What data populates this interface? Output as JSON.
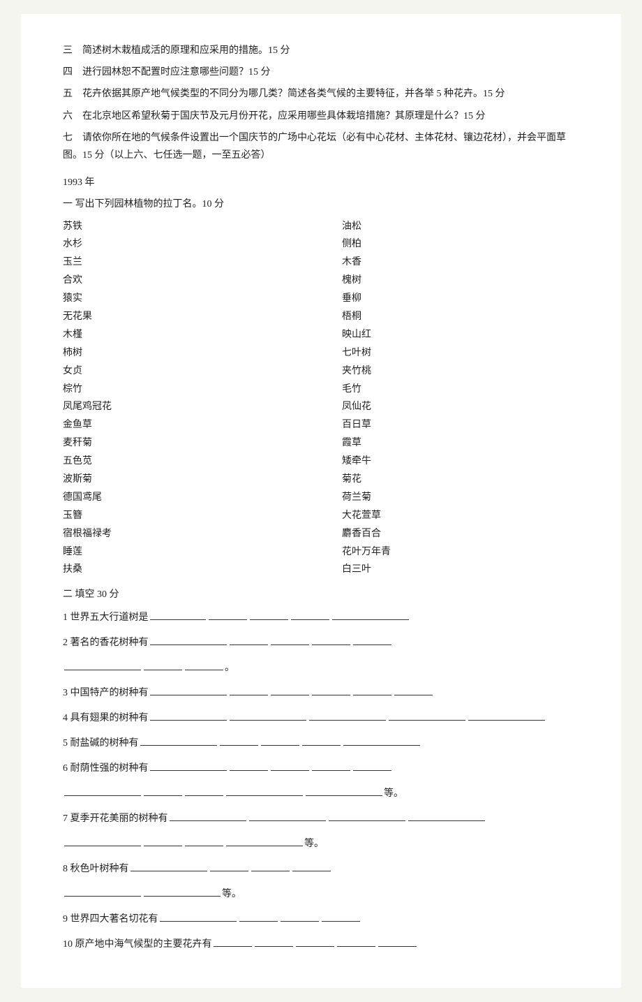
{
  "questions_top": [
    {
      "num": "三",
      "text": "简述树木栽植成活的原理和应采用的措施。15 分"
    },
    {
      "num": "四",
      "text": "进行园林恕不配置时应注意哪些问题？15 分"
    },
    {
      "num": "五",
      "text": "花卉依据其原产地气候类型的不同分为哪几类？简述各类气候的主要特征，并各举 5 种花卉。15 分"
    },
    {
      "num": "六",
      "text": "在北京地区希望秋菊于国庆节及元月份开花，应采用哪些具体栽培措施？其原理是什么？15 分"
    },
    {
      "num": "七",
      "text": "请依你所在地的气候条件设置出一个国庆节的广场中心花坛（必有中心花材、主体花材、镶边花材），并会平面草图。15 分（以上六、七任选一题，一至五必答）"
    }
  ],
  "year": "1993 年",
  "section_one_title": "一  写出下列园林植物的拉丁名。10 分",
  "plants_left": [
    "苏铁",
    "水杉",
    "玉兰",
    "合欢",
    "猿实",
    "无花果",
    "木槿",
    "柿树",
    "女贞",
    "棕竹",
    "凤尾鸡冠花",
    "金鱼草",
    "麦秆菊",
    "五色苋",
    "波斯菊",
    "德国鸢尾",
    "玉簪",
    "宿根福禄考",
    "睡莲",
    "扶桑"
  ],
  "plants_right": [
    "油松",
    "侧柏",
    "木香",
    "槐树",
    "垂柳",
    "梧桐",
    "映山红",
    "七叶树",
    "夹竹桃",
    "毛竹",
    "凤仙花",
    "百日草",
    "霞草",
    "矮牵牛",
    "菊花",
    "荷兰菊",
    "大花萱草",
    "麝香百合",
    "花叶万年青",
    "白三叶"
  ],
  "section_two_title": "二  填空 30 分",
  "fill_items": [
    {
      "num": "1",
      "text": "世界五大行道树是",
      "blanks": 5,
      "blank_sizes": [
        "lg",
        "sm",
        "sm",
        "sm",
        "lg"
      ]
    },
    {
      "num": "2",
      "text": "著名的香花树种有",
      "blanks": 5,
      "blank_sizes": [
        "lg",
        "sm",
        "sm",
        "sm",
        "sm"
      ],
      "extra_line": true,
      "extra_blanks": 3,
      "dot": true
    },
    {
      "num": "3",
      "text": "中国特产的树种有",
      "blanks": 6,
      "blank_sizes": [
        "lg",
        "sm",
        "sm",
        "sm",
        "sm",
        "sm"
      ]
    },
    {
      "num": "4",
      "text": "具有翅果的树种有",
      "blanks": 5,
      "blank_sizes": [
        "lg",
        "lg",
        "lg",
        "lg",
        "lg"
      ]
    },
    {
      "num": "5",
      "text": "耐盐碱的树种有",
      "blanks": 5,
      "blank_sizes": [
        "lg",
        "sm",
        "sm",
        "sm",
        "lg"
      ]
    },
    {
      "num": "6",
      "text": "耐荫性强的树种有",
      "blanks": 5,
      "blank_sizes": [
        "lg",
        "sm",
        "sm",
        "sm",
        "sm"
      ],
      "extra_line": true,
      "extra_blanks": 4,
      "etc": true
    },
    {
      "num": "7",
      "text": "夏季开花美丽的树种有",
      "blanks": 4,
      "blank_sizes": [
        "lg",
        "lg",
        "lg",
        "lg"
      ],
      "extra_line": true,
      "extra_blanks": 4,
      "etc": true
    },
    {
      "num": "8",
      "text": "秋色叶树种有",
      "blanks": 4,
      "blank_sizes": [
        "lg",
        "sm",
        "sm",
        "sm"
      ],
      "extra_line": true,
      "extra_blanks": 2,
      "etc": true
    },
    {
      "num": "9",
      "text": "世界四大著名切花有",
      "blanks": 4,
      "blank_sizes": [
        "lg",
        "sm",
        "sm",
        "sm"
      ]
    },
    {
      "num": "10",
      "text": "原产地中海气候型的主要花卉有",
      "blanks": 5,
      "blank_sizes": [
        "sm",
        "sm",
        "sm",
        "sm",
        "sm"
      ]
    }
  ]
}
